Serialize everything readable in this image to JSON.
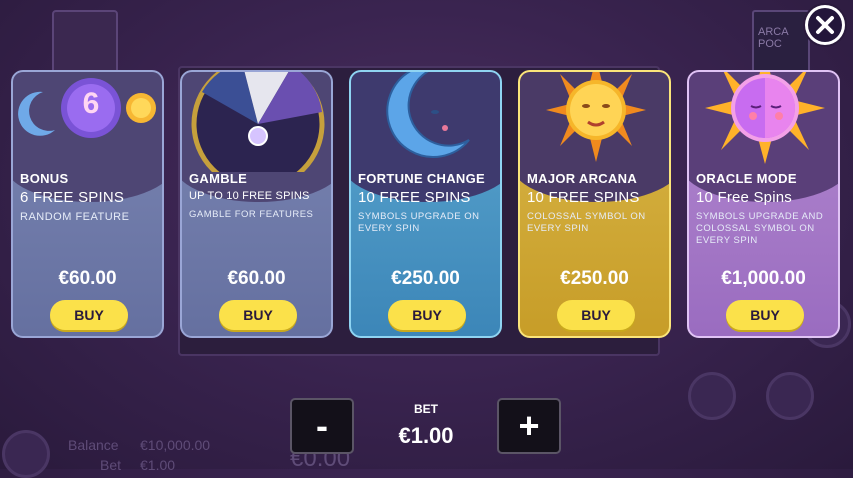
{
  "background": {
    "card_top_text": "ARCA POC",
    "balance_label": "Balance",
    "balance_value": "€10,000.00",
    "bet_label": "Bet",
    "bet_value": "€1.00",
    "win_value": "€0.00"
  },
  "close_button": {
    "icon": "close-icon"
  },
  "cards": [
    {
      "id": "bonus",
      "title": "BONUS",
      "spins": "6 FREE SPINS",
      "description": "RANDOM FEATURE",
      "price": "€60.00",
      "buy_label": "BUY",
      "art_number": "6"
    },
    {
      "id": "gamble",
      "title": "GAMBLE",
      "spins": "UP TO 10 FREE SPINS",
      "description": "GAMBLE FOR FEATURES",
      "price": "€60.00",
      "buy_label": "BUY"
    },
    {
      "id": "fortune",
      "title": "FORTUNE CHANGE",
      "spins": "10 FREE SPINS",
      "description": "SYMBOLS UPGRADE ON EVERY SPIN",
      "price": "€250.00",
      "buy_label": "BUY"
    },
    {
      "id": "major",
      "title": "MAJOR ARCANA",
      "spins": "10 FREE SPINS",
      "description": "COLOSSAL SYMBOL ON EVERY SPIN",
      "price": "€250.00",
      "buy_label": "BUY"
    },
    {
      "id": "oracle",
      "title": "ORACLE MODE",
      "spins": "10 Free Spins",
      "description": "SYMBOLS UPGRADE AND COLOSSAL SYMBOL ON EVERY SPIN",
      "price": "€1,000.00",
      "buy_label": "BUY"
    }
  ],
  "bet": {
    "label": "BET",
    "value": "€1.00",
    "minus": "-",
    "plus": "+"
  },
  "colors": {
    "buy_button": "#fbe14a",
    "fortune_card": "#4b97c5",
    "major_card": "#d0a93a",
    "oracle_card": "#a679c7"
  }
}
